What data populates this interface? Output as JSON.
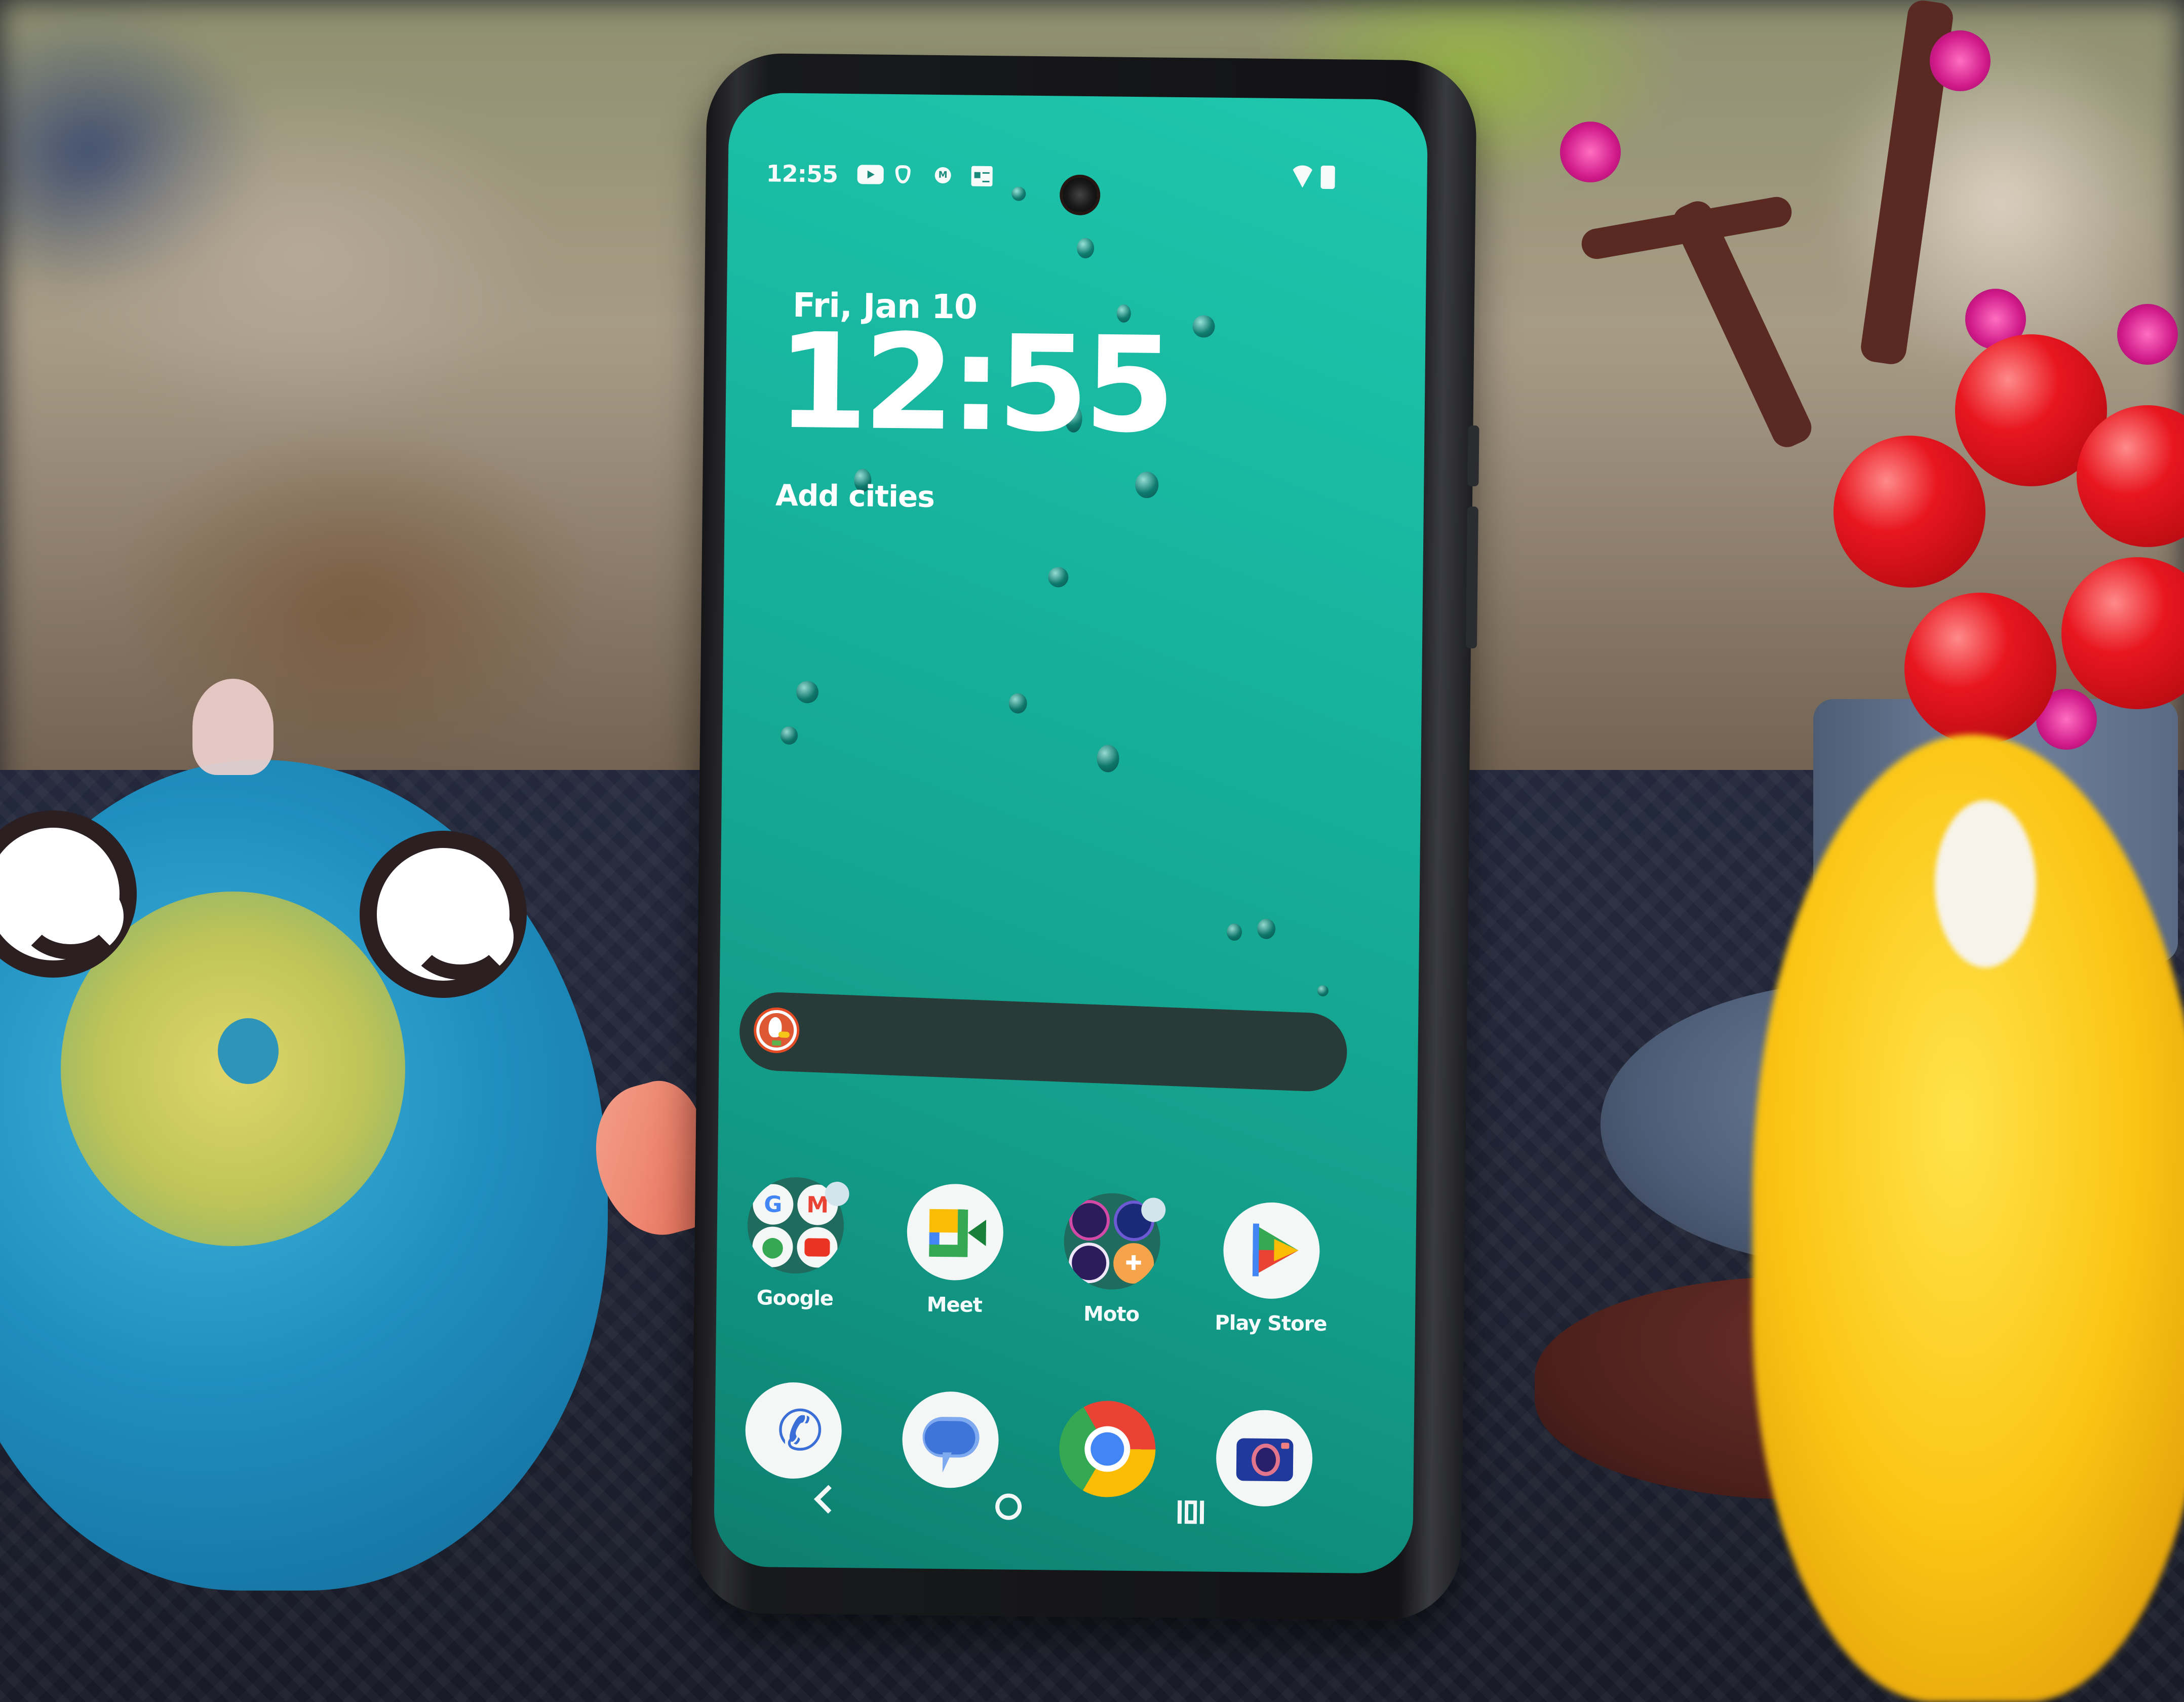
{
  "status_bar": {
    "time": "12:55",
    "notification_icons": [
      "youtube-icon",
      "shield-icon",
      "motorola-icon",
      "news-icon"
    ],
    "system_icons": [
      "wifi-icon",
      "battery-icon"
    ]
  },
  "clock_widget": {
    "date": "Fri, Jan 10",
    "time": "12:55",
    "add_cities_label": "Add cities"
  },
  "search_bar": {
    "provider_icon": "duckduckgo-icon",
    "placeholder": ""
  },
  "home_apps": [
    {
      "label": "Google",
      "type": "folder",
      "has_notification_dot": true,
      "contents": [
        "google-icon",
        "gmail-icon",
        "maps-icon",
        "youtube-icon"
      ]
    },
    {
      "label": "Meet",
      "type": "app",
      "icon": "google-meet-icon"
    },
    {
      "label": "Moto",
      "type": "folder",
      "has_notification_dot": true,
      "contents": [
        "moto-app-icon",
        "moto-secure-icon",
        "moto-connect-icon",
        "moto-gamemode-icon"
      ]
    },
    {
      "label": "Play Store",
      "type": "app",
      "icon": "play-store-icon"
    }
  ],
  "dock_apps": [
    {
      "name": "Phone",
      "icon": "phone-icon"
    },
    {
      "name": "Messages",
      "icon": "messages-icon"
    },
    {
      "name": "Chrome",
      "icon": "chrome-icon"
    },
    {
      "name": "Camera",
      "icon": "camera-icon"
    }
  ],
  "nav_bar": {
    "buttons": [
      "back",
      "home",
      "recents"
    ]
  },
  "colors": {
    "wallpaper_top": "#1fc7ad",
    "wallpaper_bottom": "#0d7e70",
    "search_bar": "#283b38",
    "icon_background": "#f4f7f6",
    "folder_background": "#1f6b5d"
  }
}
